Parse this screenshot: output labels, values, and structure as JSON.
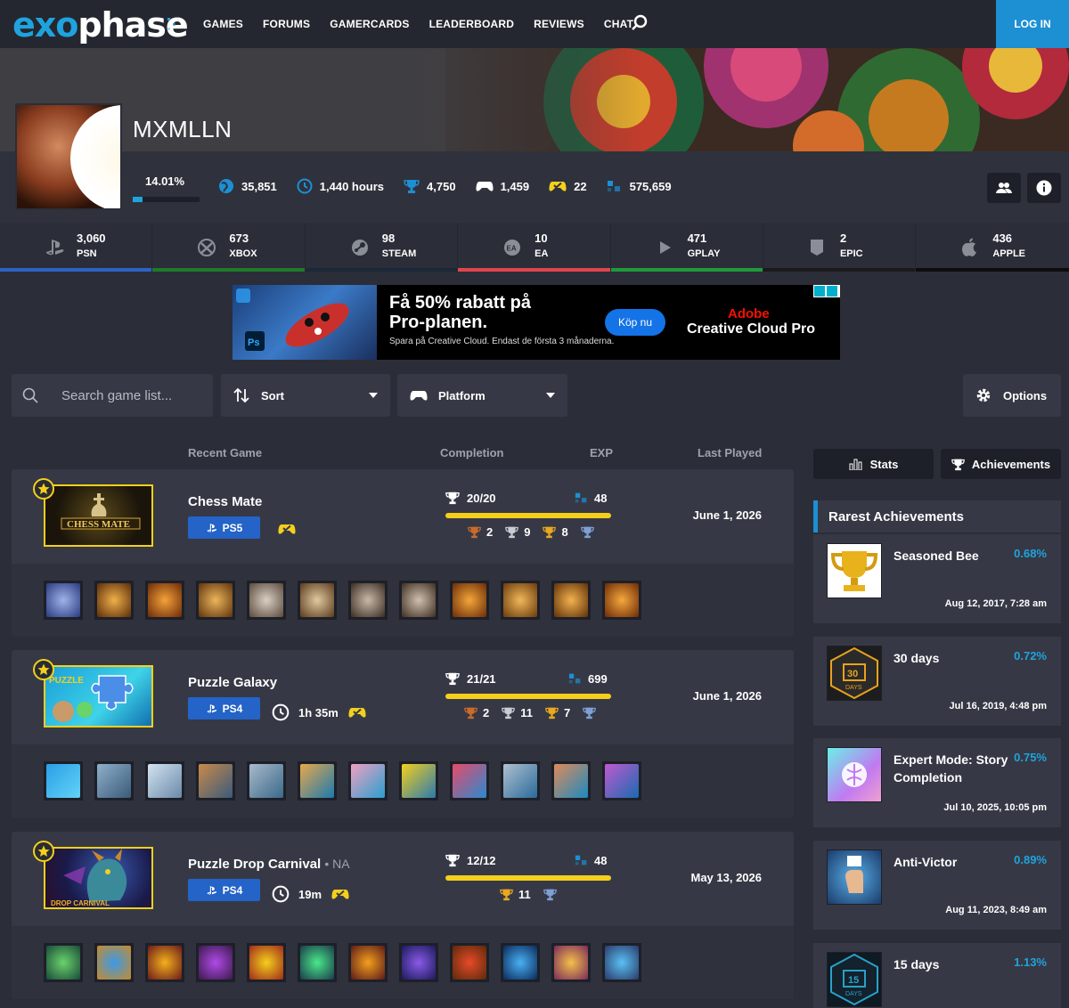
{
  "nav": {
    "logo_pre": "exo",
    "logo_post": "phase",
    "items": [
      "GAMES",
      "FORUMS",
      "GAMERCARDS",
      "LEADERBOARD",
      "REVIEWS",
      "CHAT"
    ],
    "login": "LOG IN"
  },
  "profile": {
    "username": "MXMLLN",
    "completion": "14.01%",
    "completion_value": 14.01,
    "stats": [
      {
        "icon": "globe-icon",
        "value": "35,851"
      },
      {
        "icon": "clock-icon",
        "value": "1,440 hours"
      },
      {
        "icon": "trophy-icon",
        "value": "4,750"
      },
      {
        "icon": "gamepad-icon",
        "value": "1,459"
      },
      {
        "icon": "perfect-controller-icon",
        "value": "22"
      },
      {
        "icon": "exp-icon",
        "value": "575,659"
      }
    ]
  },
  "platforms": [
    {
      "num": "3,060",
      "label": "PSN",
      "color": "#2c62c5",
      "icon": "playstation-icon"
    },
    {
      "num": "673",
      "label": "XBOX",
      "color": "#1f7b2a",
      "icon": "xbox-icon"
    },
    {
      "num": "98",
      "label": "STEAM",
      "color": "#1b2838",
      "icon": "steam-icon"
    },
    {
      "num": "10",
      "label": "EA",
      "color": "#e0464e",
      "icon": "ea-icon"
    },
    {
      "num": "471",
      "label": "GPLAY",
      "color": "#1f9a3a",
      "icon": "google-play-icon"
    },
    {
      "num": "2",
      "label": "EPIC",
      "color": "#1a1a1a",
      "icon": "epic-icon"
    },
    {
      "num": "436",
      "label": "APPLE",
      "color": "#0d0d0d",
      "icon": "apple-icon"
    }
  ],
  "ad": {
    "headline1": "Få 50% rabatt på",
    "headline2": "Pro-planen.",
    "sub": "Spara på Creative Cloud. Endast de första 3 månaderna.",
    "button": "Köp nu",
    "brand1": "Adobe",
    "brand2": "Creative Cloud Pro"
  },
  "filters": {
    "search_placeholder": "Search game list...",
    "sort": "Sort",
    "platform": "Platform",
    "options": "Options"
  },
  "list_header": {
    "game": "Recent Game",
    "completion": "Completion",
    "exp": "EXP",
    "last": "Last Played"
  },
  "games": [
    {
      "title": "Chess Mate",
      "region": "",
      "platform": "PS5",
      "playtime": "",
      "trophies": "20/20",
      "exp": "48",
      "completion": 100,
      "bronze": "2",
      "silver": "9",
      "gold": "8",
      "platinum": true,
      "last_played": "June 1, 2026"
    },
    {
      "title": "Puzzle Galaxy",
      "region": "",
      "platform": "PS4",
      "playtime": "1h 35m",
      "trophies": "21/21",
      "exp": "699",
      "completion": 100,
      "bronze": "2",
      "silver": "11",
      "gold": "7",
      "platinum": true,
      "last_played": "June 1, 2026"
    },
    {
      "title": "Puzzle Drop Carnival",
      "region": "NA",
      "platform": "PS4",
      "playtime": "19m",
      "trophies": "12/12",
      "exp": "48",
      "completion": 100,
      "bronze": "",
      "silver": "",
      "gold": "11",
      "platinum": true,
      "last_played": "May 13, 2026"
    }
  ],
  "sidebar": {
    "stats": "Stats",
    "achievements": "Achievements",
    "rarest_title": "Rarest Achievements",
    "rarest": [
      {
        "name": "Seasoned Bee",
        "pct": "0.68%",
        "date": "Aug 12, 2017, 7:28 am"
      },
      {
        "name": "30 days",
        "pct": "0.72%",
        "date": "Jul 16, 2019, 4:48 pm"
      },
      {
        "name": "Expert Mode: Story Completion",
        "pct": "0.75%",
        "date": "Jul 10, 2025, 10:05 pm"
      },
      {
        "name": "Anti-Victor",
        "pct": "0.89%",
        "date": "Aug 11, 2023, 8:49 am"
      },
      {
        "name": "15 days",
        "pct": "1.13%",
        "date": ""
      }
    ]
  },
  "colors": {
    "accent": "#1d8fd3",
    "gold": "#f4d01c",
    "bronze": "#c96b2a",
    "silver": "#c9ccd2",
    "platinum": "#7fa0d6"
  }
}
